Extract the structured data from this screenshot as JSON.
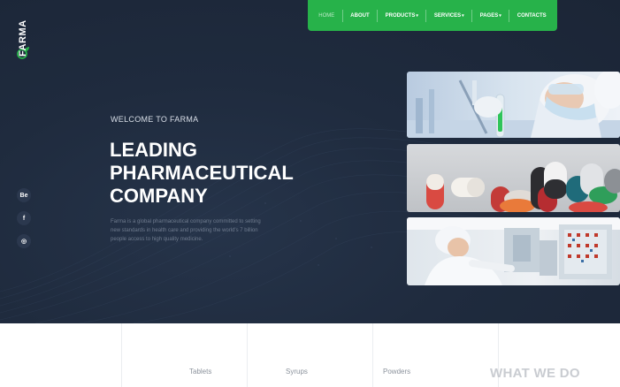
{
  "brand": {
    "name": "FARMA"
  },
  "nav": {
    "items": [
      {
        "label": "HOME",
        "active": true,
        "dropdown": false
      },
      {
        "label": "ABOUT",
        "active": false,
        "dropdown": false
      },
      {
        "label": "PRODUCTS",
        "active": false,
        "dropdown": true
      },
      {
        "label": "SERVICES",
        "active": false,
        "dropdown": true
      },
      {
        "label": "PAGES",
        "active": false,
        "dropdown": true
      },
      {
        "label": "CONTACTS",
        "active": false,
        "dropdown": false
      }
    ]
  },
  "social": [
    {
      "label": "Be",
      "icon": "behance-icon"
    },
    {
      "label": "f",
      "icon": "facebook-icon"
    },
    {
      "label": "◎",
      "icon": "instagram-icon"
    }
  ],
  "hero": {
    "eyebrow": "WELCOME TO FARMA",
    "headline": [
      "LEADING",
      "PHARMACEUTICAL",
      "COMPANY"
    ],
    "description": "Farma is a global pharmaceutical company committed to setting new standards in health care and providing the world's 7 billion people access to high quality medicine."
  },
  "features": {
    "items": [
      "Tablets",
      "Syrups",
      "Powders"
    ],
    "section_title": "WHAT WE DO"
  },
  "colors": {
    "accent": "#27b24a",
    "hero_bg": "#1f2b3e",
    "text_muted": "#6f7b8e"
  }
}
